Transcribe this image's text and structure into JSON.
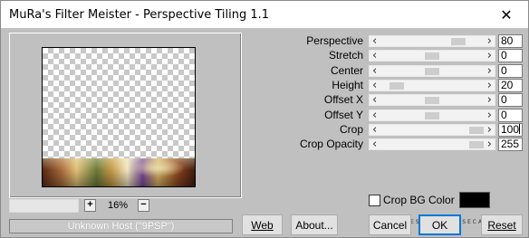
{
  "window": {
    "title": "MuRa's Filter Meister - Perspective Tiling 1.1",
    "close_glyph": "✕"
  },
  "preview": {
    "zoom_plus": "+",
    "zoom_value": "16%",
    "zoom_minus": "−",
    "host": "Unknown Host (\"9PSP\")"
  },
  "sliders": [
    {
      "label": "Perspective",
      "value": "80",
      "level": 0.8
    },
    {
      "label": "Stretch",
      "value": "0",
      "level": 0.5
    },
    {
      "label": "Center",
      "value": "0",
      "level": 0.5
    },
    {
      "label": "Height",
      "value": "20",
      "level": 0.1
    },
    {
      "label": "Offset X",
      "value": "0",
      "level": 0.5
    },
    {
      "label": "Offset Y",
      "value": "0",
      "level": 0.5
    },
    {
      "label": "Crop",
      "value": "100",
      "level": 1.0
    },
    {
      "label": "Crop Opacity",
      "value": "255",
      "level": 1.0
    }
  ],
  "arrows": {
    "left": "‹",
    "right": "›"
  },
  "crop_bg": {
    "label": "Crop BG Color",
    "checked": false,
    "swatch_color": "#000000"
  },
  "author_signature": "ESTELA FONSECA",
  "buttons": {
    "web": "Web",
    "about": "About...",
    "cancel": "Cancel",
    "ok": "OK",
    "reset": "Reset"
  }
}
